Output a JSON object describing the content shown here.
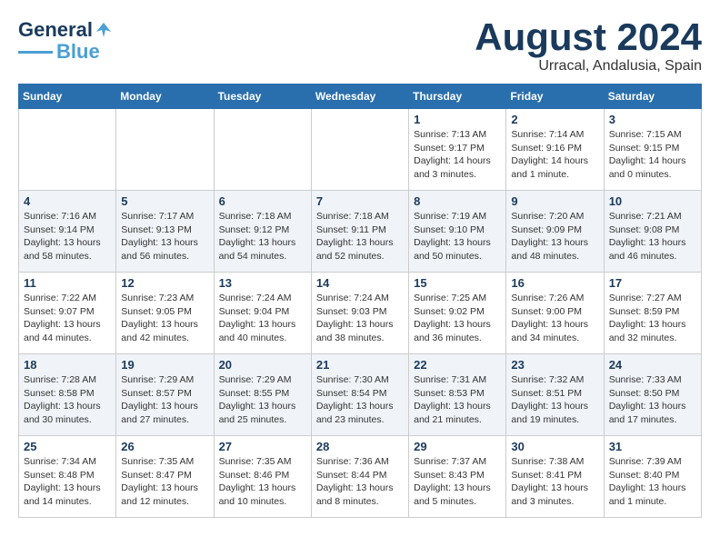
{
  "header": {
    "logo_line1": "General",
    "logo_line2": "Blue",
    "month_year": "August 2024",
    "location": "Urracal, Andalusia, Spain"
  },
  "weekdays": [
    "Sunday",
    "Monday",
    "Tuesday",
    "Wednesday",
    "Thursday",
    "Friday",
    "Saturday"
  ],
  "weeks": [
    [
      {
        "day": "",
        "info": ""
      },
      {
        "day": "",
        "info": ""
      },
      {
        "day": "",
        "info": ""
      },
      {
        "day": "",
        "info": ""
      },
      {
        "day": "1",
        "info": "Sunrise: 7:13 AM\nSunset: 9:17 PM\nDaylight: 14 hours\nand 3 minutes."
      },
      {
        "day": "2",
        "info": "Sunrise: 7:14 AM\nSunset: 9:16 PM\nDaylight: 14 hours\nand 1 minute."
      },
      {
        "day": "3",
        "info": "Sunrise: 7:15 AM\nSunset: 9:15 PM\nDaylight: 14 hours\nand 0 minutes."
      }
    ],
    [
      {
        "day": "4",
        "info": "Sunrise: 7:16 AM\nSunset: 9:14 PM\nDaylight: 13 hours\nand 58 minutes."
      },
      {
        "day": "5",
        "info": "Sunrise: 7:17 AM\nSunset: 9:13 PM\nDaylight: 13 hours\nand 56 minutes."
      },
      {
        "day": "6",
        "info": "Sunrise: 7:18 AM\nSunset: 9:12 PM\nDaylight: 13 hours\nand 54 minutes."
      },
      {
        "day": "7",
        "info": "Sunrise: 7:18 AM\nSunset: 9:11 PM\nDaylight: 13 hours\nand 52 minutes."
      },
      {
        "day": "8",
        "info": "Sunrise: 7:19 AM\nSunset: 9:10 PM\nDaylight: 13 hours\nand 50 minutes."
      },
      {
        "day": "9",
        "info": "Sunrise: 7:20 AM\nSunset: 9:09 PM\nDaylight: 13 hours\nand 48 minutes."
      },
      {
        "day": "10",
        "info": "Sunrise: 7:21 AM\nSunset: 9:08 PM\nDaylight: 13 hours\nand 46 minutes."
      }
    ],
    [
      {
        "day": "11",
        "info": "Sunrise: 7:22 AM\nSunset: 9:07 PM\nDaylight: 13 hours\nand 44 minutes."
      },
      {
        "day": "12",
        "info": "Sunrise: 7:23 AM\nSunset: 9:05 PM\nDaylight: 13 hours\nand 42 minutes."
      },
      {
        "day": "13",
        "info": "Sunrise: 7:24 AM\nSunset: 9:04 PM\nDaylight: 13 hours\nand 40 minutes."
      },
      {
        "day": "14",
        "info": "Sunrise: 7:24 AM\nSunset: 9:03 PM\nDaylight: 13 hours\nand 38 minutes."
      },
      {
        "day": "15",
        "info": "Sunrise: 7:25 AM\nSunset: 9:02 PM\nDaylight: 13 hours\nand 36 minutes."
      },
      {
        "day": "16",
        "info": "Sunrise: 7:26 AM\nSunset: 9:00 PM\nDaylight: 13 hours\nand 34 minutes."
      },
      {
        "day": "17",
        "info": "Sunrise: 7:27 AM\nSunset: 8:59 PM\nDaylight: 13 hours\nand 32 minutes."
      }
    ],
    [
      {
        "day": "18",
        "info": "Sunrise: 7:28 AM\nSunset: 8:58 PM\nDaylight: 13 hours\nand 30 minutes."
      },
      {
        "day": "19",
        "info": "Sunrise: 7:29 AM\nSunset: 8:57 PM\nDaylight: 13 hours\nand 27 minutes."
      },
      {
        "day": "20",
        "info": "Sunrise: 7:29 AM\nSunset: 8:55 PM\nDaylight: 13 hours\nand 25 minutes."
      },
      {
        "day": "21",
        "info": "Sunrise: 7:30 AM\nSunset: 8:54 PM\nDaylight: 13 hours\nand 23 minutes."
      },
      {
        "day": "22",
        "info": "Sunrise: 7:31 AM\nSunset: 8:53 PM\nDaylight: 13 hours\nand 21 minutes."
      },
      {
        "day": "23",
        "info": "Sunrise: 7:32 AM\nSunset: 8:51 PM\nDaylight: 13 hours\nand 19 minutes."
      },
      {
        "day": "24",
        "info": "Sunrise: 7:33 AM\nSunset: 8:50 PM\nDaylight: 13 hours\nand 17 minutes."
      }
    ],
    [
      {
        "day": "25",
        "info": "Sunrise: 7:34 AM\nSunset: 8:48 PM\nDaylight: 13 hours\nand 14 minutes."
      },
      {
        "day": "26",
        "info": "Sunrise: 7:35 AM\nSunset: 8:47 PM\nDaylight: 13 hours\nand 12 minutes."
      },
      {
        "day": "27",
        "info": "Sunrise: 7:35 AM\nSunset: 8:46 PM\nDaylight: 13 hours\nand 10 minutes."
      },
      {
        "day": "28",
        "info": "Sunrise: 7:36 AM\nSunset: 8:44 PM\nDaylight: 13 hours\nand 8 minutes."
      },
      {
        "day": "29",
        "info": "Sunrise: 7:37 AM\nSunset: 8:43 PM\nDaylight: 13 hours\nand 5 minutes."
      },
      {
        "day": "30",
        "info": "Sunrise: 7:38 AM\nSunset: 8:41 PM\nDaylight: 13 hours\nand 3 minutes."
      },
      {
        "day": "31",
        "info": "Sunrise: 7:39 AM\nSunset: 8:40 PM\nDaylight: 13 hours\nand 1 minute."
      }
    ]
  ]
}
